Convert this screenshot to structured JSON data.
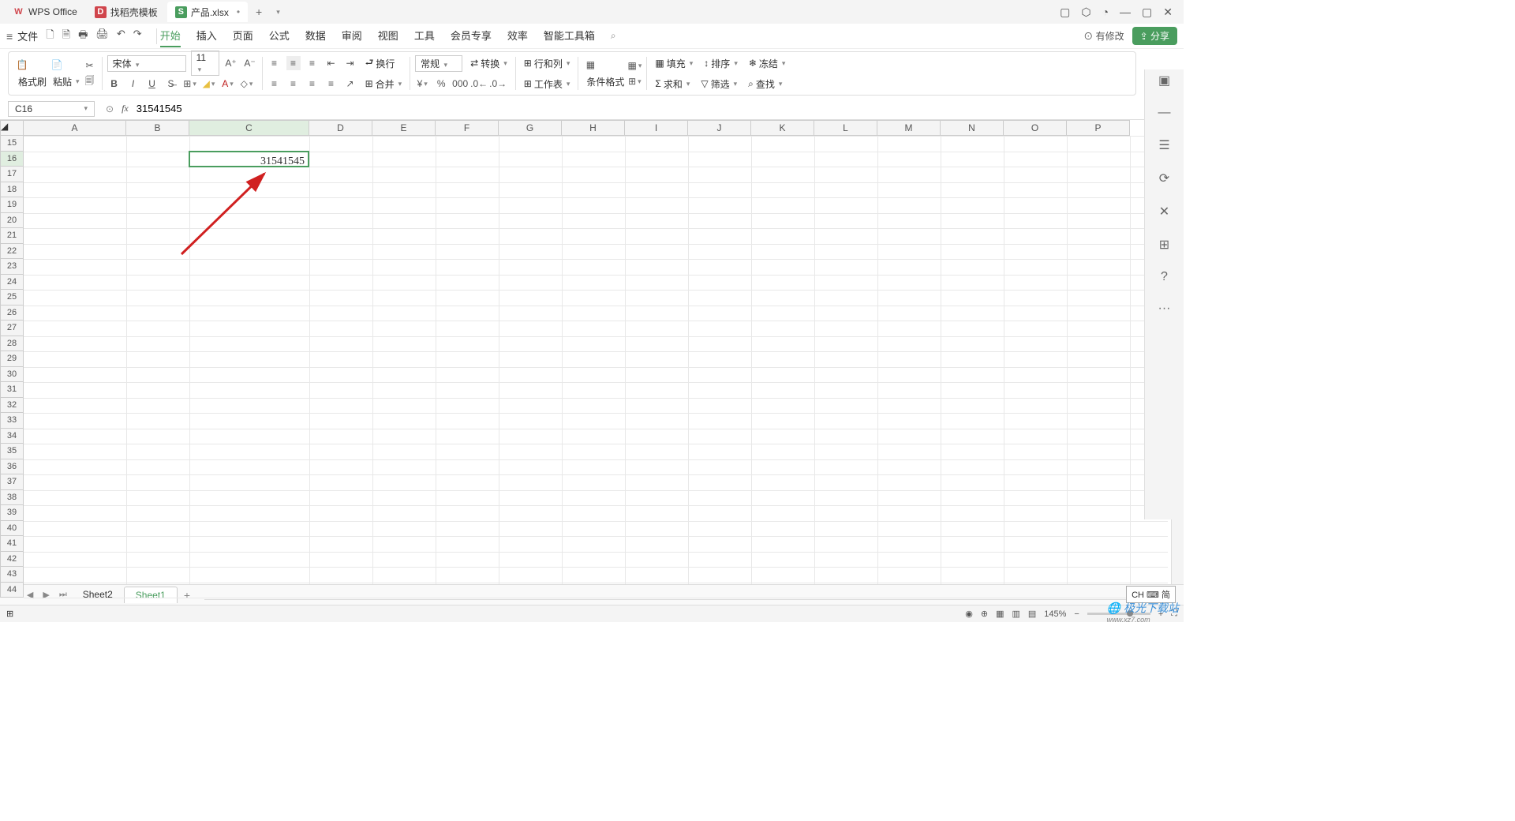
{
  "title_tabs": [
    {
      "icon": "W",
      "cls": "w",
      "label": "WPS Office"
    },
    {
      "icon": "D",
      "cls": "d",
      "label": "找稻壳模板"
    },
    {
      "icon": "S",
      "cls": "s",
      "label": "产品.xlsx",
      "dot": "•"
    }
  ],
  "win_icons": [
    "▢",
    "⬡",
    "◔",
    "—",
    "▢",
    "✕"
  ],
  "file_label": "文件",
  "qat": [
    "🗋",
    "🗎",
    "🖶",
    "🖨",
    "↶",
    "↷"
  ],
  "menus": [
    "开始",
    "插入",
    "页面",
    "公式",
    "数据",
    "审阅",
    "视图",
    "工具",
    "会员专享",
    "效率",
    "智能工具箱"
  ],
  "active_menu": 0,
  "cloud": "⊙ 有修改",
  "share": "⇪ 分享",
  "ribbon": {
    "brush": "格式刷",
    "paste": "粘贴",
    "font": "宋体",
    "size": "11",
    "normal": "常规",
    "convert": "转换",
    "rows_cols": "行和列",
    "worksheet": "工作表",
    "cond": "条件格式",
    "fill": "填充",
    "sort": "排序",
    "freeze": "冻结",
    "sum": "求和",
    "filter": "筛选",
    "find": "查找",
    "wrap": "换行",
    "merge": "合并"
  },
  "namebox": "C16",
  "formula": "31541545",
  "columns": [
    "A",
    "B",
    "C",
    "D",
    "E",
    "F",
    "G",
    "H",
    "I",
    "J",
    "K",
    "L",
    "M",
    "N",
    "O",
    "P"
  ],
  "active_col": 2,
  "row_start": 15,
  "row_end": 44,
  "active_row": 16,
  "cell_value": "31541545",
  "sheets": [
    "Sheet2",
    "Sheet1"
  ],
  "active_sheet": 1,
  "zoom": "145%",
  "ime": "CH ⌨ 简",
  "watermark": "极光下载站",
  "watermark_url": "www.xz7.com",
  "sb_icons": [
    "◉",
    "⊕",
    "▦",
    "▥",
    "▤"
  ],
  "rail_icons": [
    "▣",
    "—",
    "☰",
    "⟳",
    "✕",
    "⊞",
    "?",
    "···"
  ]
}
